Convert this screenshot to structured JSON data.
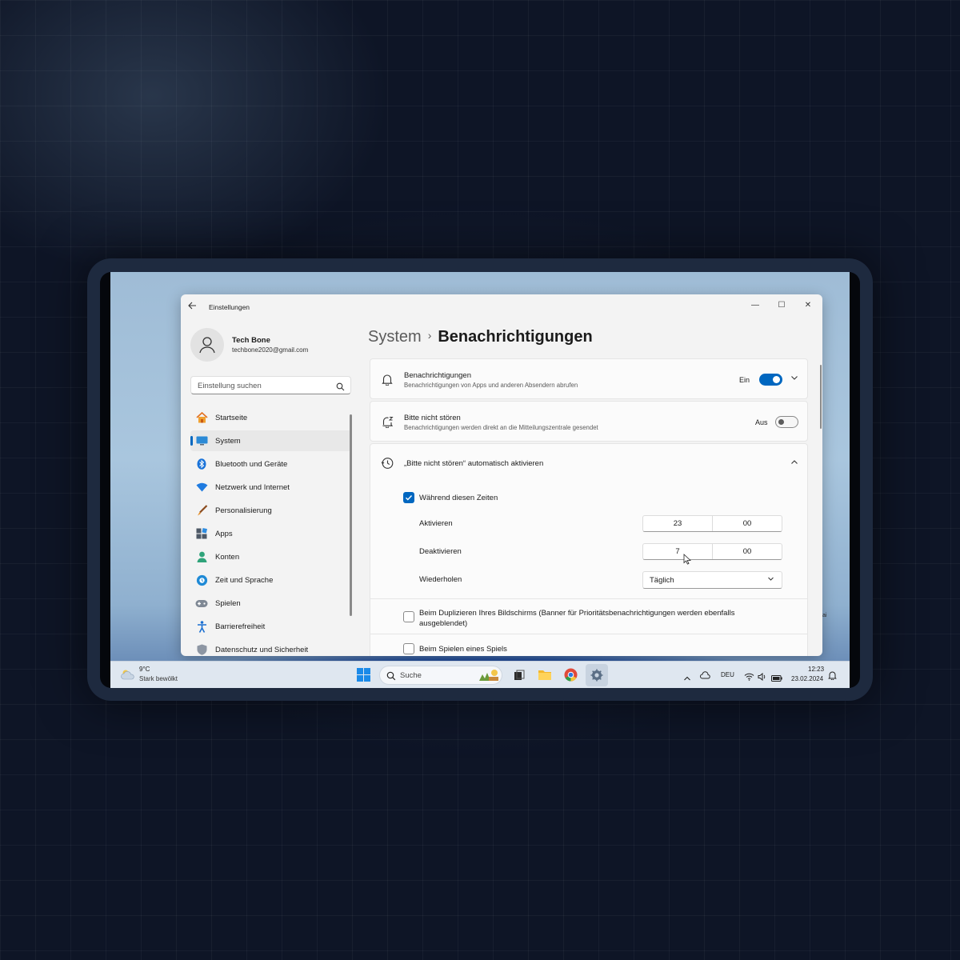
{
  "window": {
    "title": "Einstellungen",
    "back_icon": "arrow-left-icon",
    "controls": {
      "minimize": "—",
      "maximize": "☐",
      "close": "✕"
    }
  },
  "profile": {
    "name": "Tech Bone",
    "email": "techbone2020@gmail.com",
    "avatar_icon": "person-icon"
  },
  "search": {
    "placeholder": "Einstellung suchen",
    "icon": "search-icon"
  },
  "sidebar": {
    "items": [
      {
        "label": "Startseite",
        "icon": "home-icon",
        "active": false
      },
      {
        "label": "System",
        "icon": "monitor-icon",
        "active": true
      },
      {
        "label": "Bluetooth und Geräte",
        "icon": "bluetooth-icon",
        "active": false
      },
      {
        "label": "Netzwerk und Internet",
        "icon": "wifi-icon",
        "active": false
      },
      {
        "label": "Personalisierung",
        "icon": "brush-icon",
        "active": false
      },
      {
        "label": "Apps",
        "icon": "apps-icon",
        "active": false
      },
      {
        "label": "Konten",
        "icon": "account-icon",
        "active": false
      },
      {
        "label": "Zeit und Sprache",
        "icon": "globe-clock-icon",
        "active": false
      },
      {
        "label": "Spielen",
        "icon": "gamepad-icon",
        "active": false
      },
      {
        "label": "Barrierefreiheit",
        "icon": "accessibility-icon",
        "active": false
      },
      {
        "label": "Datenschutz und Sicherheit",
        "icon": "shield-icon",
        "active": false
      }
    ]
  },
  "breadcrumb": {
    "parent": "System",
    "separator": "›",
    "current": "Benachrichtigungen"
  },
  "notifications": {
    "title": "Benachrichtigungen",
    "subtitle": "Benachrichtigungen von Apps und anderen Absendern abrufen",
    "toggle_label": "Ein",
    "toggle_on": true
  },
  "dnd": {
    "title": "Bitte nicht stören",
    "subtitle": "Benachrichtigungen werden direkt an die Mitteilungszentrale gesendet",
    "toggle_label": "Aus",
    "toggle_on": false
  },
  "auto_dnd": {
    "title": "„Bitte nicht stören“ automatisch aktivieren",
    "during_times_label": "Während diesen Zeiten",
    "during_times_checked": true,
    "activate_label": "Aktivieren",
    "activate_hour": "23",
    "activate_minute": "00",
    "deactivate_label": "Deaktivieren",
    "deactivate_hour": "7",
    "deactivate_minute": "00",
    "repeat_label": "Wiederholen",
    "repeat_value": "Täglich",
    "duplicate_label_line1": "Beim Duplizieren Ihres Bildschirms (Banner für Prioritätsbenachrichtigungen werden ebenfalls",
    "duplicate_label_line2": "ausgeblendet)",
    "duplicate_checked": false,
    "gaming_label": "Beim Spielen eines Spiels",
    "gaming_checked": false
  },
  "taskbar": {
    "weather_temp": "9°C",
    "weather_desc": "Stark bewölkt",
    "search_label": "Suche",
    "language": "DEU",
    "time": "12:23",
    "date": "23.02.2024"
  },
  "colors": {
    "accent": "#0067c0",
    "window_bg": "#f3f3f3",
    "card_bg": "#fbfbfb"
  }
}
